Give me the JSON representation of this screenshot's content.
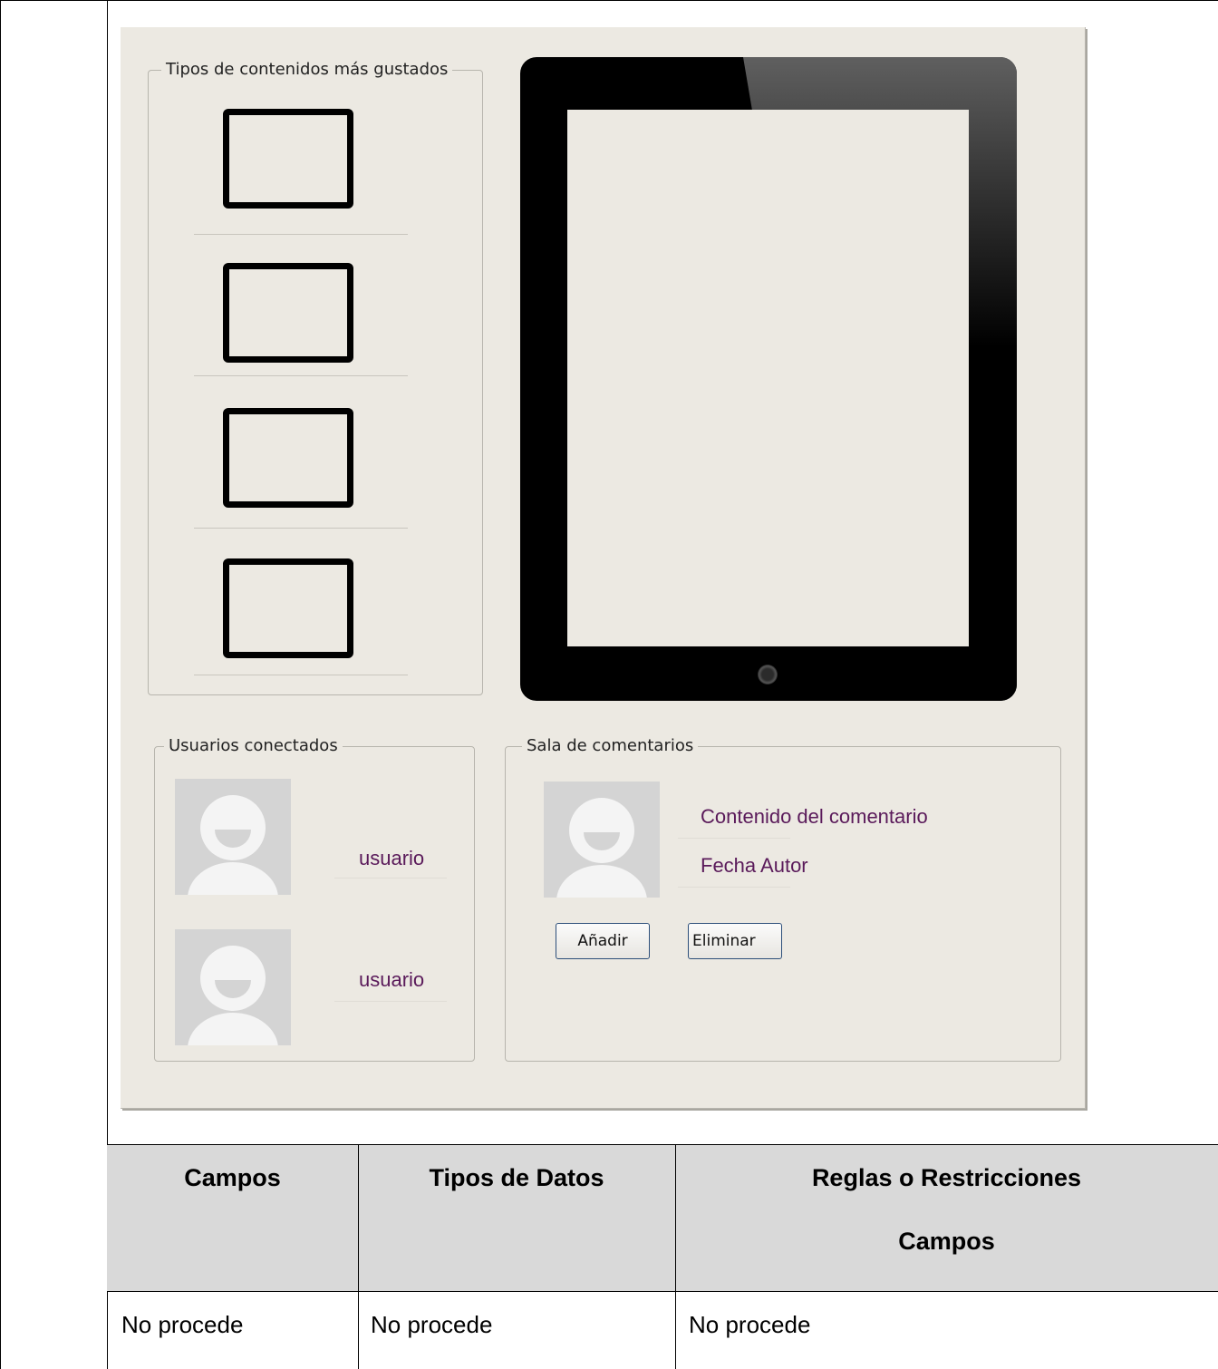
{
  "groups": {
    "liked": "Tipos de contenidos más gustados",
    "users": "Usuarios conectados",
    "comments": "Sala de comentarios"
  },
  "users": [
    {
      "name": "usuario"
    },
    {
      "name": "usuario"
    }
  ],
  "comment": {
    "content": "Contenido del comentario",
    "meta": "Fecha Autor"
  },
  "buttons": {
    "add": "Añadir",
    "delete": "Eliminar"
  },
  "table": {
    "headers": [
      "Campos",
      "Tipos de Datos",
      "Reglas o Restricciones",
      "Campos"
    ],
    "row": [
      "No procede",
      "No procede",
      "No procede"
    ]
  },
  "colors": {
    "window_bg": "#ece9e2",
    "header_bg": "#d9d9d9",
    "label_text": "#5a1a5a"
  }
}
